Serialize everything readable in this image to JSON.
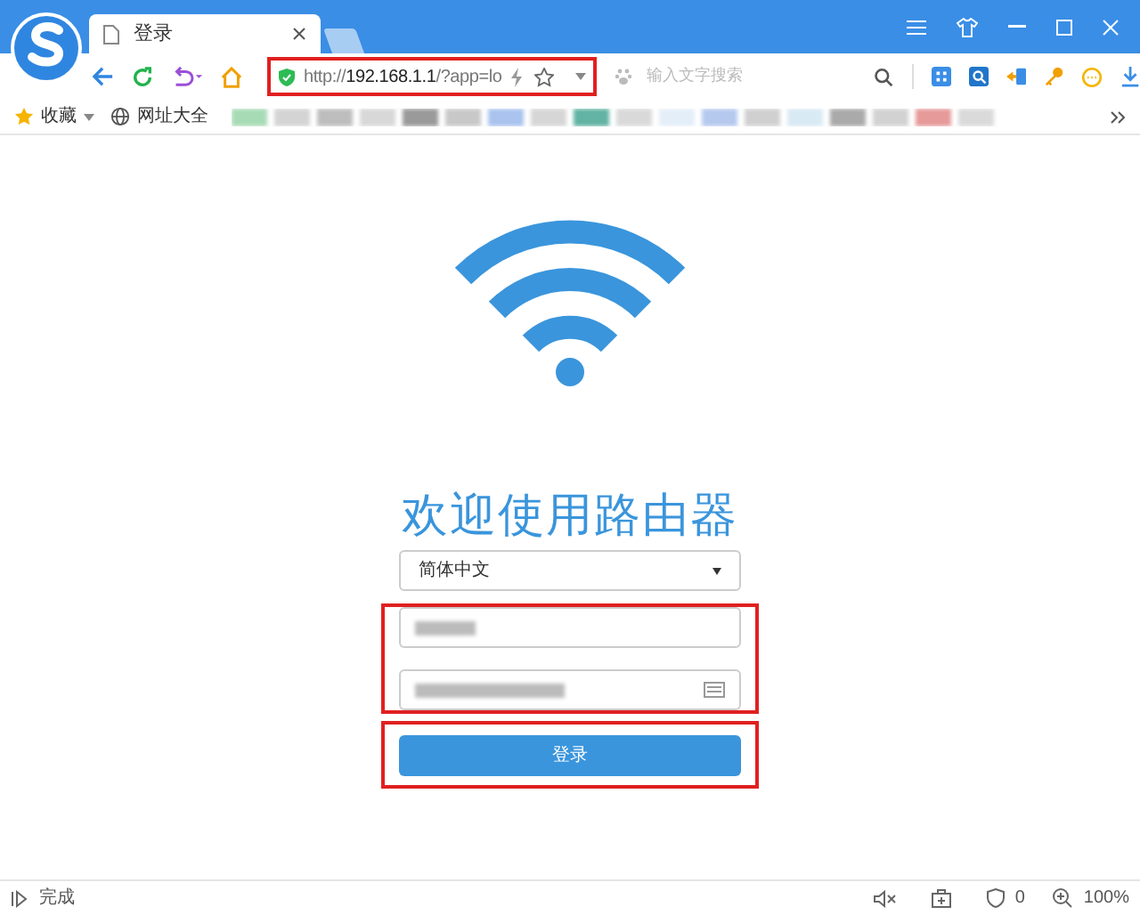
{
  "tab": {
    "title": "登录"
  },
  "address_bar": {
    "url_prefix": "http://",
    "url_host": "192.168.1.1",
    "url_rest": "/?app=lo"
  },
  "search": {
    "placeholder": "输入文字搜索"
  },
  "bookmarks": [
    {
      "label": "收藏",
      "kind": "favorites"
    },
    {
      "label": "网址大全",
      "kind": "globe"
    }
  ],
  "page": {
    "heading": "欢迎使用路由器",
    "language": "简体中文",
    "login_button": "登录"
  },
  "status_bar": {
    "text": "完成",
    "shield_count": "0",
    "zoom": "100%"
  }
}
